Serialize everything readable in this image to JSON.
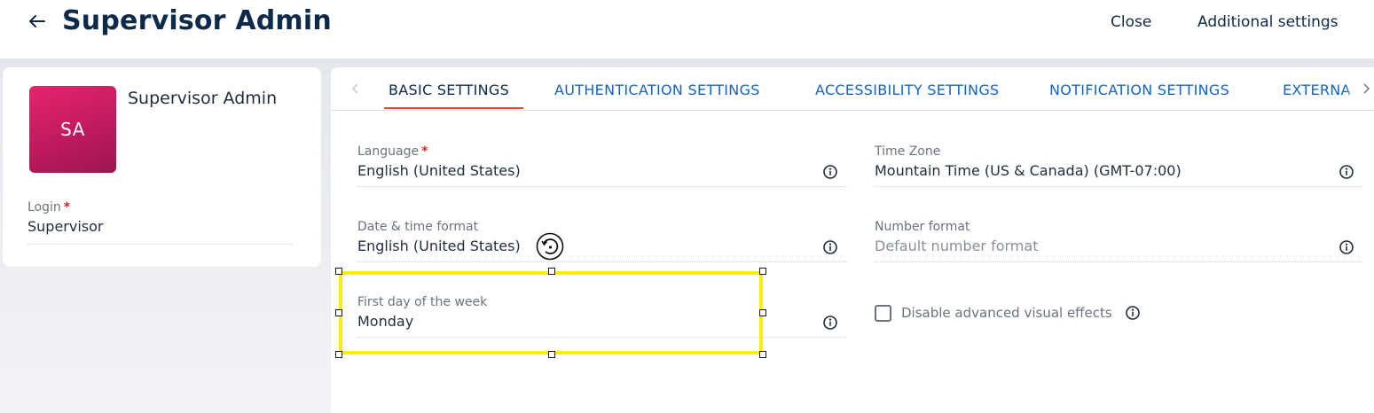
{
  "header": {
    "back_icon": "arrow-left-icon",
    "title": "Supervisor Admin",
    "close_label": "Close",
    "additional_settings_label": "Additional settings"
  },
  "profile": {
    "avatar_initials": "SA",
    "avatar_color": "#d81b66",
    "name": "Supervisor Admin",
    "login": {
      "label": "Login",
      "required_marker": "*",
      "value": "Supervisor"
    }
  },
  "tabs": {
    "items": [
      {
        "label": "BASIC SETTINGS",
        "active": true
      },
      {
        "label": "AUTHENTICATION SETTINGS",
        "active": false
      },
      {
        "label": "ACCESSIBILITY SETTINGS",
        "active": false
      },
      {
        "label": "NOTIFICATION SETTINGS",
        "active": false
      },
      {
        "label": "EXTERNA",
        "active": false
      }
    ],
    "active_underline_color": "#e2462b",
    "link_color": "#1565c0"
  },
  "form": {
    "language": {
      "label": "Language",
      "required_marker": "*",
      "value": "English (United States)"
    },
    "time_zone": {
      "label": "Time Zone",
      "value": "Mountain Time (US & Canada) (GMT-07:00)"
    },
    "date_time_format": {
      "label": "Date & time format",
      "value": "English (United States)"
    },
    "number_format": {
      "label": "Number format",
      "placeholder": "Default number format"
    },
    "first_day_of_week": {
      "label": "First day of the week",
      "value": "Monday"
    },
    "disable_visual_effects": {
      "label": "Disable advanced visual effects",
      "checked": false
    }
  },
  "selection": {
    "highlight_color": "#ffee00"
  }
}
